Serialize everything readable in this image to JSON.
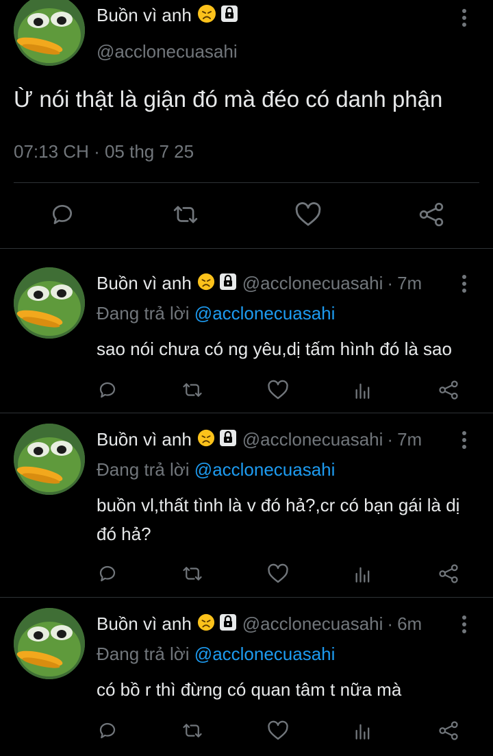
{
  "main_post": {
    "display_name": "Buồn vì anh",
    "handle": "@acclonecuasahi",
    "text": "Ừ nói thật là giận đó mà đéo có danh phận",
    "timestamp": "07:13 CH · 05 thg 7 25"
  },
  "replies": [
    {
      "display_name": "Buồn vì anh",
      "handle": "@acclonecuasahi",
      "separator": "·",
      "time": "7m",
      "replying_prefix": "Đang trả lời",
      "replying_to": "@acclonecuasahi",
      "text": "sao nói chưa có ng yêu,dị tấm hình đó là sao"
    },
    {
      "display_name": "Buồn vì anh",
      "handle": "@acclonecuasahi",
      "separator": "·",
      "time": "7m",
      "replying_prefix": "Đang trả lời",
      "replying_to": "@acclonecuasahi",
      "text": "buồn vl,thất tình là v đó hả?,cr có bạn gái là dị đó hả?"
    },
    {
      "display_name": "Buồn vì anh",
      "handle": "@acclonecuasahi",
      "separator": "·",
      "time": "6m",
      "replying_prefix": "Đang trả lời",
      "replying_to": "@acclonecuasahi",
      "text": "có bồ r thì đừng có quan tâm t nữa mà"
    }
  ],
  "icons": {
    "reply": "reply-icon",
    "retweet": "retweet-icon",
    "like": "heart-icon",
    "views": "views-icon",
    "share": "share-icon",
    "more": "more-vertical-icon",
    "sad_emoji": "sad-face-emoji-icon",
    "lock": "lock-icon"
  },
  "colors": {
    "background": "#000000",
    "text": "#e7e9ea",
    "secondary": "#71767b",
    "mention": "#1d9bf0",
    "divider": "#2f3336"
  }
}
